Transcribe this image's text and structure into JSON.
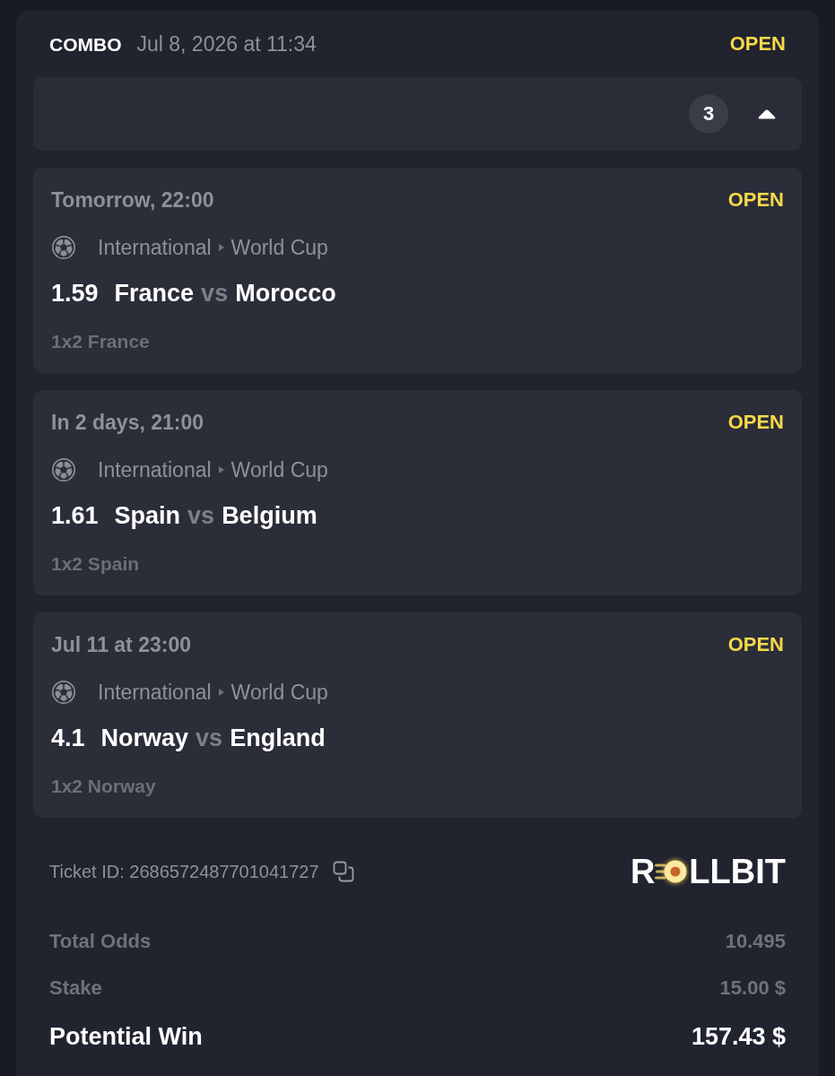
{
  "header": {
    "bet_type": "COMBO",
    "placed_at": "Jul 8, 2026 at 11:34",
    "status": "OPEN"
  },
  "legs_toggle": {
    "count": "3",
    "expanded": true
  },
  "legs": [
    {
      "time": "Tomorrow, 22:00",
      "status": "OPEN",
      "category": "International",
      "league": "World Cup",
      "odds": "1.59",
      "home": "France",
      "versus": "vs",
      "away": "Morocco",
      "market": "1x2 France"
    },
    {
      "time": "In 2 days, 21:00",
      "status": "OPEN",
      "category": "International",
      "league": "World Cup",
      "odds": "1.61",
      "home": "Spain",
      "versus": "vs",
      "away": "Belgium",
      "market": "1x2 Spain"
    },
    {
      "time": "Jul 11 at 23:00",
      "status": "OPEN",
      "category": "International",
      "league": "World Cup",
      "odds": "4.1",
      "home": "Norway",
      "versus": "vs",
      "away": "England",
      "market": "1x2 Norway"
    }
  ],
  "footer": {
    "ticket_id": "Ticket ID: 2686572487701041727",
    "logo": {
      "before": "R",
      "after": "LLBIT"
    }
  },
  "totals": [
    {
      "kind": "muted",
      "label": "Total Odds",
      "value": "10.495"
    },
    {
      "kind": "muted",
      "label": "Stake",
      "value": "15.00 $"
    },
    {
      "kind": "emphasis",
      "label": "Potential Win",
      "value": "157.43 $"
    }
  ]
}
